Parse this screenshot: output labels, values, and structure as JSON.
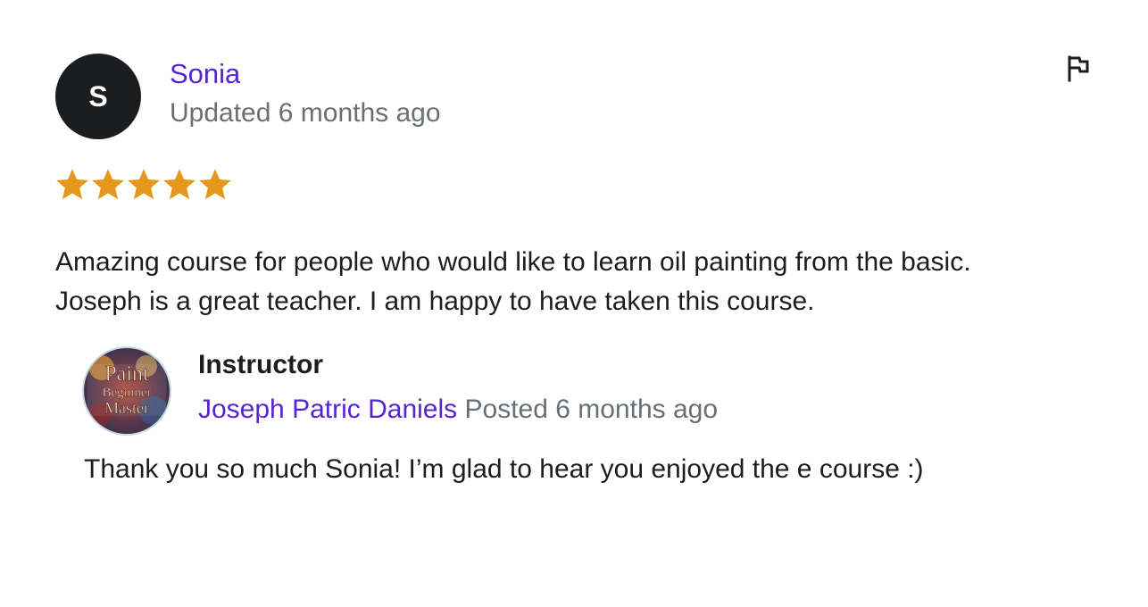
{
  "review": {
    "avatar_initial": "S",
    "reviewer_name": "Sonia",
    "updated": "Updated 6 months ago",
    "rating": 5,
    "max_rating": 5,
    "star_color": "#e59819",
    "text_line1": "Amazing course for people who would like to learn oil painting from the basic.",
    "text_line2": "Joseph is a great teacher. I am happy to have taken this course.",
    "report_icon": "flag-icon"
  },
  "response": {
    "role": "Instructor",
    "instructor_name": "Joseph Patric Daniels",
    "posted": "Posted 6 months ago",
    "avatar_logo_lines": [
      "Paint",
      "Beginner",
      "Master"
    ],
    "text": "Thank you so much Sonia! I’m glad to hear you enjoyed the e course :)"
  },
  "colors": {
    "link": "#5624d0",
    "muted": "#6a6f73",
    "text": "#1c1d1f",
    "avatar_bg": "#1c1d1f"
  }
}
